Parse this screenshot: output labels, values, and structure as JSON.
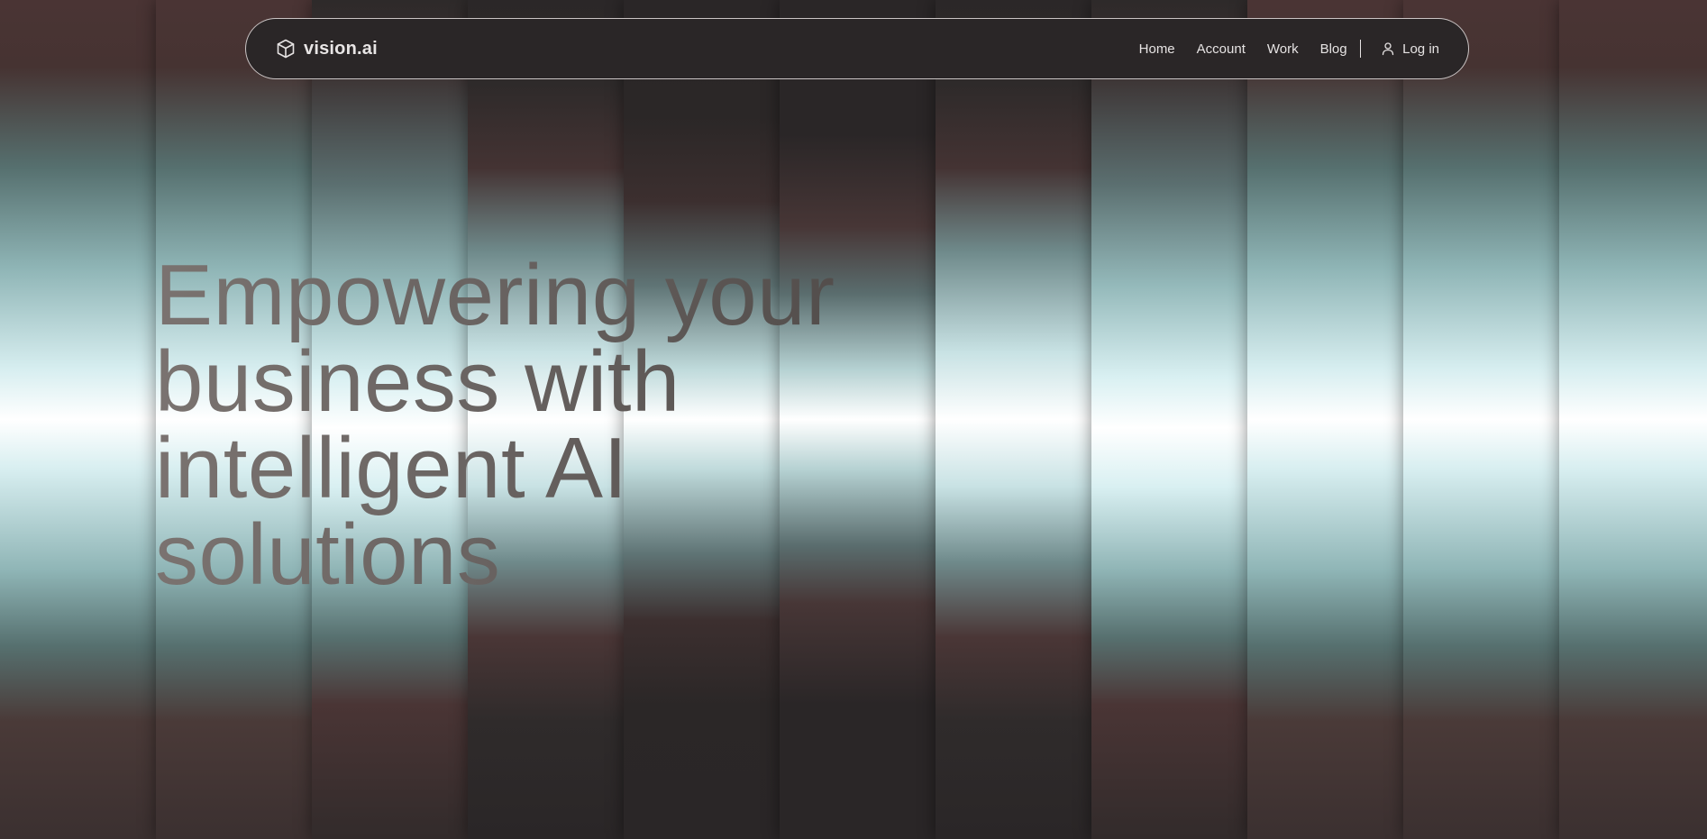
{
  "header": {
    "brand": {
      "icon": "cube-icon",
      "name": "vision.ai"
    },
    "nav": [
      {
        "label": "Home"
      },
      {
        "label": "Account"
      },
      {
        "label": "Work"
      },
      {
        "label": "Blog"
      }
    ],
    "login": {
      "icon": "user-icon",
      "label": "Log in"
    }
  },
  "hero": {
    "headline": "Empowering your\nbusiness with\nintelligent AI\nsolutions"
  },
  "colors": {
    "background": "#2a2627",
    "text_light": "#e6e3e3",
    "headline_gray": "#6a6563",
    "stripe_teal": "#8fb5b6",
    "stripe_red": "#4a3434"
  }
}
